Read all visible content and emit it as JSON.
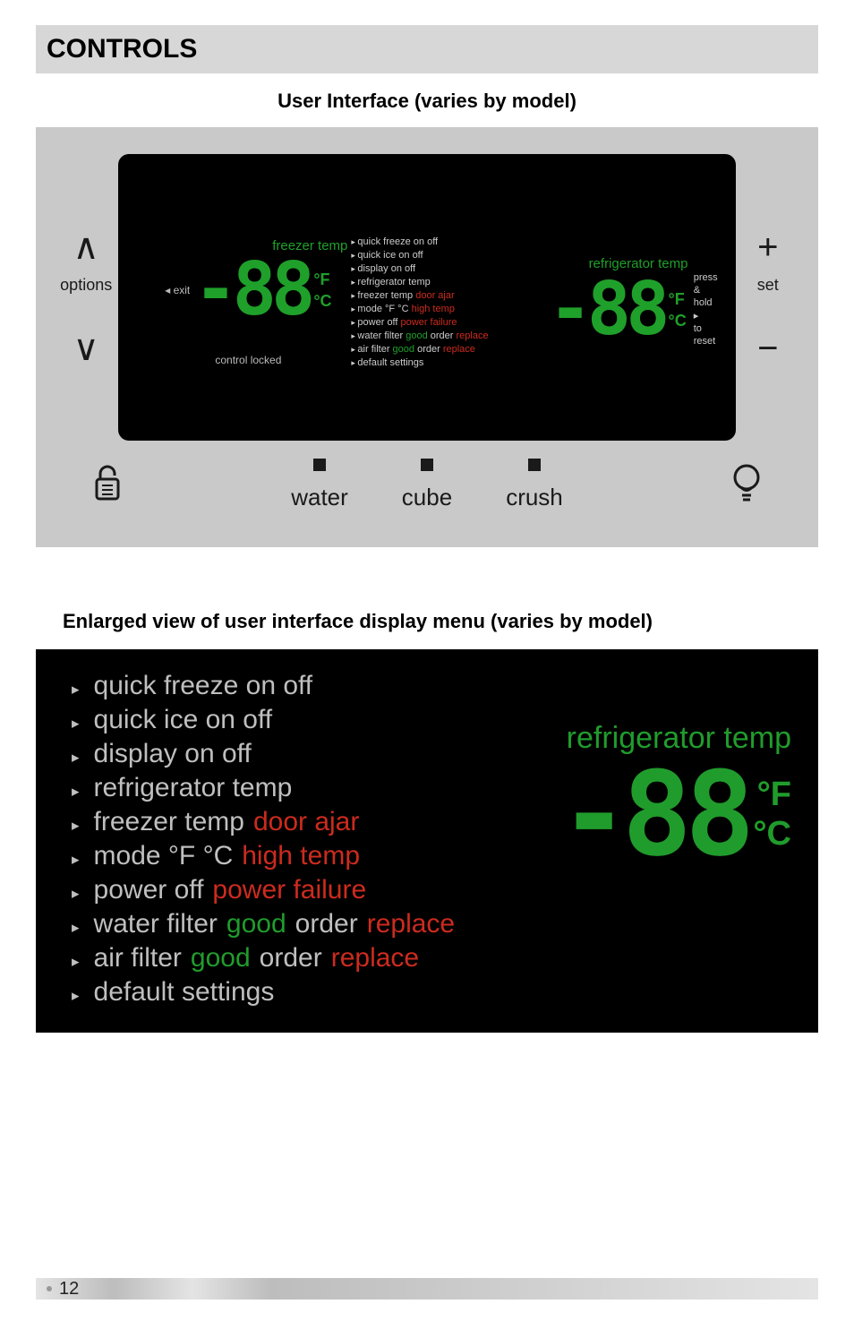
{
  "section_title": "CONTROLS",
  "subtitle": "User Interface (varies by model)",
  "left_buttons": {
    "up_glyph": "∧",
    "label": "options",
    "down_glyph": "∨"
  },
  "right_buttons": {
    "plus_glyph": "+",
    "label": "set",
    "minus_glyph": "−"
  },
  "screen": {
    "freezer_label": "freezer temp",
    "exit_label": "◂ exit",
    "seg_value": "-88",
    "deg_f": "°F",
    "deg_c": "°C",
    "control_locked": "control locked",
    "refrigerator_label": "refrigerator temp",
    "press_hold": [
      "press &",
      "hold  ▸",
      "to reset"
    ],
    "menu": [
      {
        "text": "quick freeze  on  off"
      },
      {
        "text": "quick ice  on  off"
      },
      {
        "text": "display  on  off"
      },
      {
        "text": "refrigerator temp"
      },
      {
        "text": "freezer temp",
        "red": "door ajar"
      },
      {
        "text": "mode °F °C",
        "red": "high temp"
      },
      {
        "text": "power off",
        "red": "power failure"
      },
      {
        "text": "water filter",
        "green": "good",
        "tail": "order",
        "red": "replace"
      },
      {
        "text": "air filter",
        "green": "good",
        "tail": "order",
        "red": "replace"
      },
      {
        "text": "default settings"
      }
    ]
  },
  "dispense": {
    "water": "water",
    "cube": "cube",
    "crush": "crush"
  },
  "enlarged_title": "Enlarged view of user interface display menu (varies by model)",
  "enlarged": {
    "refrigerator_label": "refrigerator temp",
    "seg_value": "-88",
    "deg_f": "°F",
    "deg_c": "°C",
    "items": [
      {
        "parts": [
          {
            "t": "quick freeze  on  off"
          }
        ]
      },
      {
        "parts": [
          {
            "t": "quick ice   on  off"
          }
        ]
      },
      {
        "parts": [
          {
            "t": "display  on  off"
          }
        ]
      },
      {
        "parts": [
          {
            "t": "refrigerator temp"
          }
        ]
      },
      {
        "parts": [
          {
            "t": "freezer temp"
          },
          {
            "t": "door ajar",
            "c": "bred"
          }
        ]
      },
      {
        "parts": [
          {
            "t": "mode °F °C"
          },
          {
            "t": "high temp",
            "c": "bred"
          }
        ]
      },
      {
        "parts": [
          {
            "t": "power off"
          },
          {
            "t": "power failure",
            "c": "bred"
          }
        ]
      },
      {
        "parts": [
          {
            "t": "water filter"
          },
          {
            "t": "good",
            "c": "bgreen"
          },
          {
            "t": "order"
          },
          {
            "t": "replace",
            "c": "bred"
          }
        ]
      },
      {
        "parts": [
          {
            "t": "air filter"
          },
          {
            "t": "good",
            "c": "bgreen"
          },
          {
            "t": "order"
          },
          {
            "t": "replace",
            "c": "bred"
          }
        ]
      },
      {
        "parts": [
          {
            "t": "default settings"
          }
        ]
      }
    ]
  },
  "page_number": "12"
}
